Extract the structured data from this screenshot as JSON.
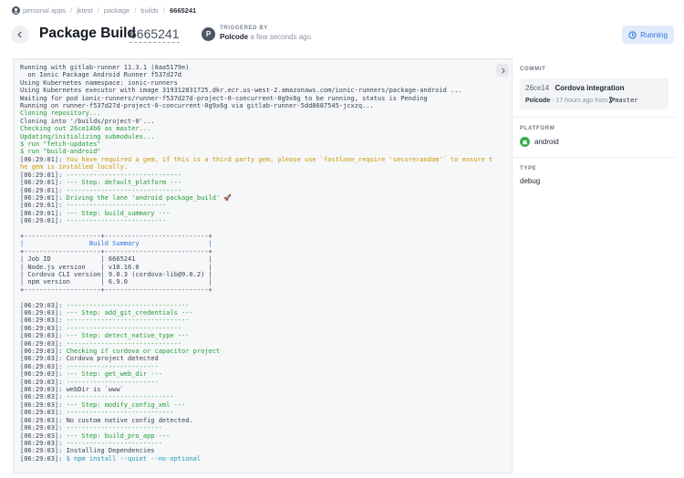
{
  "breadcrumb": {
    "org": "personal apps",
    "items": [
      "jktest",
      "package",
      "builds"
    ],
    "current": "6665241"
  },
  "header": {
    "title": "Package Build",
    "build_id": "6665241",
    "trigger_label": "TRIGGERED BY",
    "trigger_avatar": "P",
    "trigger_user": "Polcode",
    "trigger_time": "a few seconds ago",
    "status": "Running",
    "status_color": "#2e73dc"
  },
  "log": {
    "lines": [
      {
        "t": "Running with gitlab-runner 11.3.1 (0aa5179e)",
        "c": ""
      },
      {
        "t": "  on Ionic Package Android Runner f537d27d",
        "c": ""
      },
      {
        "t": "Using Kubernetes namespace: ionic-runners",
        "c": ""
      },
      {
        "t": "Using Kubernetes executor with image 319312831725.dkr.ecr.us-west-2.amazonaws.com/ionic-runners/package-android ...",
        "c": ""
      },
      {
        "t": "Waiting for pod ionic-runners/runner-f537d27d-project-0-concurrent-0g9x6g to be running, status is Pending",
        "c": ""
      },
      {
        "t": "Running on runner-f537d27d-project-0-concurrent-0g9x6g via gitlab-runner-5dd8687545-jcxzq...",
        "c": ""
      },
      {
        "t": "Cloning repository...",
        "c": "green"
      },
      {
        "t": "Cloning into '/builds/project-0'...",
        "c": ""
      },
      {
        "t": "Checking out 26ce14b6 as master...",
        "c": "green"
      },
      {
        "t": "Updating/initializing submodules...",
        "c": "green"
      },
      {
        "t": "$ run \"fetch-updates\"",
        "c": "green"
      },
      {
        "t": "$ run \"build-android\"",
        "c": "green"
      },
      {
        "t": "[06:29:01]: You have required a gem, if this is a third party gem, please use `fastlane_require 'securerandom'` to ensure t",
        "c": "yellow",
        "p": "[06:29:01]: "
      },
      {
        "t": "he gem is installed locally.",
        "c": "yellow"
      },
      {
        "t": "[06:29:01]: ------------------------------",
        "c": "green",
        "p": "[06:29:01]: "
      },
      {
        "t": "[06:29:01]: --- Step: default_platform ---",
        "c": "green",
        "p": "[06:29:01]: "
      },
      {
        "t": "[06:29:01]: ------------------------------",
        "c": "green",
        "p": "[06:29:01]: "
      },
      {
        "t": "[06:29:01]: Driving the lane 'android package_build' 🚀",
        "c": "green",
        "p": "[06:29:01]: "
      },
      {
        "t": "[06:29:01]: --------------------------",
        "c": "green",
        "p": "[06:29:01]: "
      },
      {
        "t": "[06:29:01]: --- Step: build_summary ---",
        "c": "green",
        "p": "[06:29:01]: "
      },
      {
        "t": "[06:29:01]: --------------------------",
        "c": "green",
        "p": "[06:29:01]: "
      },
      {
        "t": "",
        "c": ""
      },
      {
        "t": "+--------------------+---------------------------+",
        "c": ""
      },
      {
        "t": "|                 Build Summary                  |",
        "c": "",
        "h": true
      },
      {
        "t": "+--------------------+---------------------------+",
        "c": ""
      },
      {
        "t": "| Job ID             | 6665241                   |",
        "c": ""
      },
      {
        "t": "| Node.js version    | v10.16.0                  |",
        "c": ""
      },
      {
        "t": "| Cordova CLI version| 9.0.3 (cordova-lib@9.0.2) |",
        "c": ""
      },
      {
        "t": "| npm version        | 6.9.0                     |",
        "c": ""
      },
      {
        "t": "+--------------------+---------------------------+",
        "c": ""
      },
      {
        "t": "",
        "c": ""
      },
      {
        "t": "[06:29:03]: --------------------------------",
        "c": "green",
        "p": "[06:29:03]: "
      },
      {
        "t": "[06:29:03]: --- Step: add_git_credentials ---",
        "c": "green",
        "p": "[06:29:03]: "
      },
      {
        "t": "[06:29:03]: --------------------------------",
        "c": "green",
        "p": "[06:29:03]: "
      },
      {
        "t": "[06:29:03]: ------------------------------",
        "c": "green",
        "p": "[06:29:03]: "
      },
      {
        "t": "[06:29:03]: --- Step: detect_native_type ---",
        "c": "green",
        "p": "[06:29:03]: "
      },
      {
        "t": "[06:29:03]: ------------------------------",
        "c": "green",
        "p": "[06:29:03]: "
      },
      {
        "t": "[06:29:03]: Checking if cordova or capacitor project",
        "c": "green",
        "p": "[06:29:03]: "
      },
      {
        "t": "[06:29:03]: Cordova project detected",
        "c": ""
      },
      {
        "t": "[06:29:03]: ------------------------",
        "c": "green",
        "p": "[06:29:03]: "
      },
      {
        "t": "[06:29:03]: --- Step: get_web_dir ---",
        "c": "green",
        "p": "[06:29:03]: "
      },
      {
        "t": "[06:29:03]: ------------------------",
        "c": "green",
        "p": "[06:29:03]: "
      },
      {
        "t": "[06:29:03]: webDir is `www`",
        "c": ""
      },
      {
        "t": "[06:29:03]: ----------------------------",
        "c": "green",
        "p": "[06:29:03]: "
      },
      {
        "t": "[06:29:03]: --- Step: modify_config_xml ---",
        "c": "green",
        "p": "[06:29:03]: "
      },
      {
        "t": "[06:29:03]: ----------------------------",
        "c": "green",
        "p": "[06:29:03]: "
      },
      {
        "t": "[06:29:03]: No custom native config detected.",
        "c": ""
      },
      {
        "t": "[06:29:03]: -------------------------",
        "c": "green",
        "p": "[06:29:03]: "
      },
      {
        "t": "[06:29:03]: --- Step: build_pro_app ---",
        "c": "green",
        "p": "[06:29:03]: "
      },
      {
        "t": "[06:29:03]: -------------------------",
        "c": "green",
        "p": "[06:29:03]: "
      },
      {
        "t": "[06:29:03]: Installing Dependencies",
        "c": ""
      },
      {
        "t": "[06:29:03]: $ npm install --quiet --no-optional",
        "c": "cyan",
        "p": "[06:29:03]: "
      }
    ]
  },
  "sidebar": {
    "commit_label": "COMMIT",
    "commit_sha": "26ce14",
    "commit_message": "Cordova integration",
    "commit_author": "Polcode",
    "commit_time": " - 17 hours ago from ",
    "commit_branch": "master",
    "platform_label": "PLATFORM",
    "platform_value": "android",
    "type_label": "TYPE",
    "type_value": "debug"
  }
}
